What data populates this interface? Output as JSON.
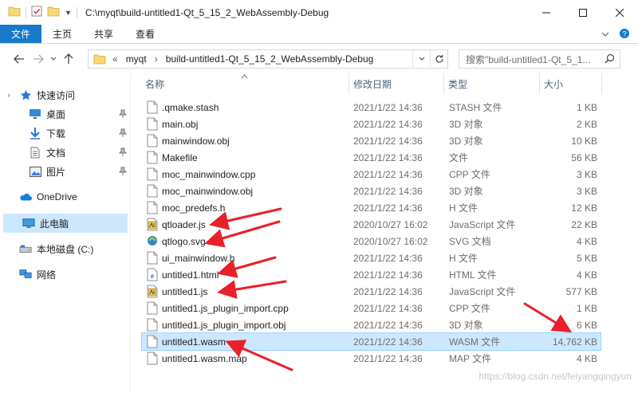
{
  "window": {
    "title": "C:\\myqt\\build-untitled1-Qt_5_15_2_WebAssembly-Debug"
  },
  "ribbon": {
    "tabs": [
      "文件",
      "主页",
      "共享",
      "查看"
    ]
  },
  "address": {
    "prefix": "«",
    "crumbs": [
      "myqt",
      "build-untitled1-Qt_5_15_2_WebAssembly-Debug"
    ]
  },
  "search": {
    "placeholder": "搜索\"build-untitled1-Qt_5_1..."
  },
  "sidebar": {
    "items": [
      {
        "label": "快速访问",
        "icon": "star-icon"
      },
      {
        "label": "桌面",
        "icon": "desktop-icon"
      },
      {
        "label": "下载",
        "icon": "download-icon"
      },
      {
        "label": "文档",
        "icon": "document-icon"
      },
      {
        "label": "图片",
        "icon": "picture-icon"
      },
      {
        "label": "OneDrive",
        "icon": "cloud-icon"
      },
      {
        "label": "此电脑",
        "icon": "computer-icon"
      },
      {
        "label": "本地磁盘 (C:)",
        "icon": "drive-icon"
      },
      {
        "label": "网络",
        "icon": "network-icon"
      }
    ]
  },
  "columns": {
    "name": "名称",
    "date": "修改日期",
    "type": "类型",
    "size": "大小"
  },
  "files": [
    {
      "name": ".qmake.stash",
      "date": "2021/1/22 14:36",
      "type": "STASH 文件",
      "size": "1 KB",
      "icon": "file-icon"
    },
    {
      "name": "main.obj",
      "date": "2021/1/22 14:36",
      "type": "3D 对象",
      "size": "2 KB",
      "icon": "file-icon"
    },
    {
      "name": "mainwindow.obj",
      "date": "2021/1/22 14:36",
      "type": "3D 对象",
      "size": "10 KB",
      "icon": "file-icon"
    },
    {
      "name": "Makefile",
      "date": "2021/1/22 14:36",
      "type": "文件",
      "size": "56 KB",
      "icon": "file-icon"
    },
    {
      "name": "moc_mainwindow.cpp",
      "date": "2021/1/22 14:36",
      "type": "CPP 文件",
      "size": "3 KB",
      "icon": "file-icon"
    },
    {
      "name": "moc_mainwindow.obj",
      "date": "2021/1/22 14:36",
      "type": "3D 对象",
      "size": "3 KB",
      "icon": "file-icon"
    },
    {
      "name": "moc_predefs.h",
      "date": "2021/1/22 14:36",
      "type": "H 文件",
      "size": "12 KB",
      "icon": "file-icon"
    },
    {
      "name": "qtloader.js",
      "date": "2020/10/27 16:02",
      "type": "JavaScript 文件",
      "size": "22 KB",
      "icon": "script-icon"
    },
    {
      "name": "qtlogo.svg",
      "date": "2020/10/27 16:02",
      "type": "SVG 文档",
      "size": "4 KB",
      "icon": "svg-icon"
    },
    {
      "name": "ui_mainwindow.h",
      "date": "2021/1/22 14:36",
      "type": "H 文件",
      "size": "5 KB",
      "icon": "file-icon"
    },
    {
      "name": "untitled1.html",
      "date": "2021/1/22 14:36",
      "type": "HTML 文件",
      "size": "4 KB",
      "icon": "html-icon"
    },
    {
      "name": "untitled1.js",
      "date": "2021/1/22 14:36",
      "type": "JavaScript 文件",
      "size": "577 KB",
      "icon": "script-icon"
    },
    {
      "name": "untitled1.js_plugin_import.cpp",
      "date": "2021/1/22 14:36",
      "type": "CPP 文件",
      "size": "1 KB",
      "icon": "file-icon"
    },
    {
      "name": "untitled1.js_plugin_import.obj",
      "date": "2021/1/22 14:36",
      "type": "3D 对象",
      "size": "6 KB",
      "icon": "file-icon"
    },
    {
      "name": "untitled1.wasm",
      "date": "2021/1/22 14:36",
      "type": "WASM 文件",
      "size": "14,762 KB",
      "icon": "file-icon",
      "selected": true
    },
    {
      "name": "untitled1.wasm.map",
      "date": "2021/1/22 14:36",
      "type": "MAP 文件",
      "size": "4 KB",
      "icon": "file-icon"
    }
  ],
  "watermark": "https://blog.csdn.net/feiyangqingyun",
  "colors": {
    "accent": "#1979ca",
    "selection": "#cce8ff",
    "annotation": "#e8202a"
  }
}
